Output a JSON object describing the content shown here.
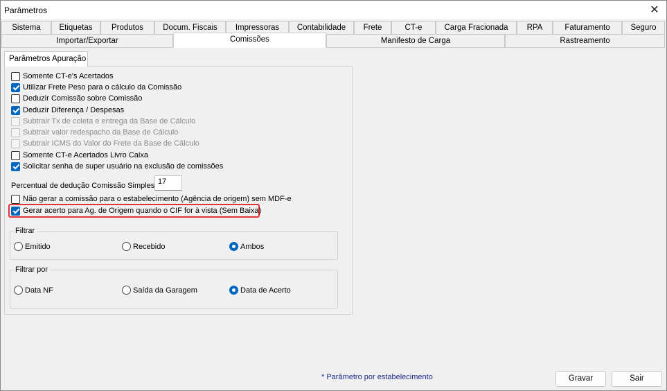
{
  "window": {
    "title": "Parâmetros",
    "close_glyph": "✕"
  },
  "tabs_row1": [
    "Sistema",
    "Etiquetas",
    "Produtos",
    "Docum. Fiscais",
    "Impressoras",
    "Contabilidade",
    "Frete",
    "CT-e",
    "Carga Fracionada",
    "RPA",
    "Faturamento",
    "Seguro"
  ],
  "tabs_row2": [
    "Importar/Exportar",
    "Comissões",
    "Manifesto de Carga",
    "Rastreamento"
  ],
  "active_tab": "Comissões",
  "subtab": "Parâmetros Apuração",
  "checkboxes": [
    {
      "label": "Somente CT-e's Acertados",
      "checked": false,
      "disabled": false
    },
    {
      "label": "Utilizar Frete Peso para o cálculo da Comissão",
      "checked": true,
      "disabled": false
    },
    {
      "label": "Deduzir Comissão sobre Comissão",
      "checked": false,
      "disabled": false
    },
    {
      "label": "Deduzir Diferença / Despesas",
      "checked": true,
      "disabled": false
    },
    {
      "label": "Subtrair Tx de coleta e entrega da Base de Cálculo",
      "checked": false,
      "disabled": true
    },
    {
      "label": "Subtrair valor redespacho da Base de Cálculo",
      "checked": false,
      "disabled": true
    },
    {
      "label": "Subtrair ICMS do Valor do Frete da Base de Cálculo",
      "checked": false,
      "disabled": true
    },
    {
      "label": "Somente CT-e Acertados Livro Caixa",
      "checked": false,
      "disabled": false
    },
    {
      "label": "Solicitar senha de super usuário na exclusão de comissões",
      "checked": true,
      "disabled": false
    }
  ],
  "percent": {
    "label": "Percentual de dedução Comissão Simples",
    "value": "17"
  },
  "checkboxes2": [
    {
      "label": "Não gerar a comissão para o estabelecimento (Agência de origem) sem MDF-e",
      "checked": false
    },
    {
      "label": "Gerar acerto para Ag. de Origem quando o CIF for à vista (Sem Baixa)",
      "checked": true
    }
  ],
  "filtrar": {
    "legend": "Filtrar",
    "options": [
      {
        "label": "Emitido",
        "checked": false
      },
      {
        "label": "Recebido",
        "checked": false
      },
      {
        "label": "Ambos",
        "checked": true
      }
    ]
  },
  "filtrar_por": {
    "legend": "Filtrar por",
    "options": [
      {
        "label": "Data NF",
        "checked": false
      },
      {
        "label": "Saída da Garagem",
        "checked": false
      },
      {
        "label": "Data de Acerto",
        "checked": true
      }
    ]
  },
  "footer": {
    "note": "* Parâmetro por estabelecimento",
    "gravar": "Gravar",
    "sair": "Sair"
  },
  "colors": {
    "accent": "#0067c0",
    "highlight": "#e0343c",
    "note": "#1b2a8c"
  }
}
